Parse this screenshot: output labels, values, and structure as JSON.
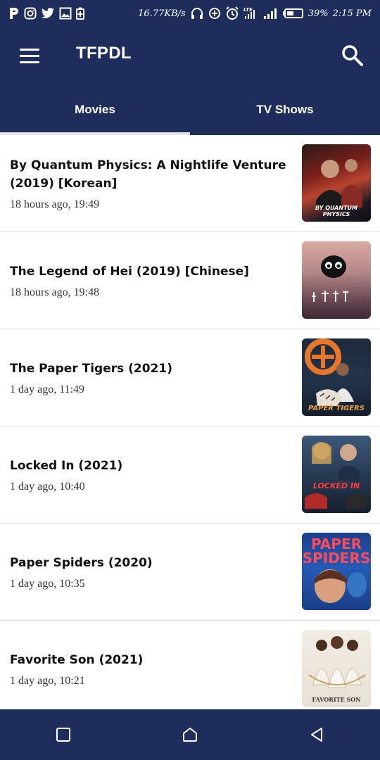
{
  "status_bar": {
    "network_speed": "16.77KB/s",
    "battery_percent": "39%",
    "time": "2:15 PM",
    "network_type": "LTE",
    "left_icons": [
      "p-app-icon",
      "instagram-icon",
      "twitter-icon",
      "gallery-icon",
      "battery-saver-icon"
    ]
  },
  "app_bar": {
    "title": "TFPDL",
    "menu_icon": "hamburger-menu-icon",
    "search_icon": "search-icon"
  },
  "tabs": [
    {
      "label": "Movies",
      "active": true
    },
    {
      "label": "TV Shows",
      "active": false
    }
  ],
  "movies": [
    {
      "title": "By Quantum Physics: A Nightlife Venture (2019) [Korean]",
      "time": "18 hours ago, 19:49",
      "poster_text": "BY QUANTUM PHYSICS"
    },
    {
      "title": "The Legend of Hei (2019) [Chinese]",
      "time": "18 hours ago, 19:48",
      "poster_text": ""
    },
    {
      "title": "The Paper Tigers (2021)",
      "time": "1 day ago, 11:49",
      "poster_text": "PAPER TIGERS"
    },
    {
      "title": "Locked In (2021)",
      "time": "1 day ago, 10:40",
      "poster_text": "LOCKED IN"
    },
    {
      "title": "Paper Spiders (2020)",
      "time": "1 day ago, 10:35",
      "poster_text": "PAPER SPIDERS"
    },
    {
      "title": "Favorite Son (2021)",
      "time": "1 day ago, 10:21",
      "poster_text": "FAVORITE SON"
    }
  ],
  "nav_bar": {
    "buttons": [
      "recents-icon",
      "home-icon",
      "back-icon"
    ]
  },
  "colors": {
    "primary": "#1f2d5c",
    "tab_indicator": "#e4e6ec",
    "text": "#111111"
  }
}
